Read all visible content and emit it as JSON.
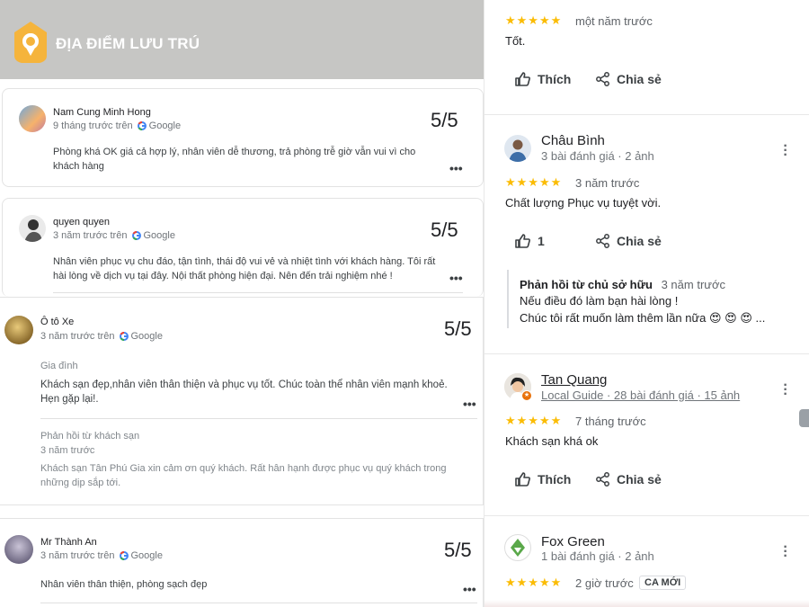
{
  "header": {
    "title": "ĐỊA ĐIỂM LƯU TRÚ"
  },
  "left_reviews": [
    {
      "name": "Nam Cung Minh Hong",
      "meta": "9 tháng trước trên",
      "source": "Google",
      "score": "5/5",
      "text": "Phòng khá OK giá cả hợp lý, nhân viên dễ thương, trả phòng trễ giờ vẫn vui vì cho khách hàng",
      "more": "•••"
    },
    {
      "name": "quyen quyen",
      "meta": "3 năm trước trên",
      "source": "Google",
      "score": "5/5",
      "text": "Nhân viên phục vụ chu đáo, tận tình, thái độ vui vẻ và nhiệt tình với khách hàng. Tôi rất hài lòng về dịch vụ tại đây. Nội thất phòng hiện đại. Nên đến trải nghiệm nhé !",
      "more": "•••"
    },
    {
      "name": "Ô tô Xe",
      "meta": "3 năm trước trên",
      "source": "Google",
      "score": "5/5",
      "tag": "Gia đình",
      "text": "Khách sạn đẹp,nhân viên thân thiện và phục vụ tốt. Chúc toàn thể nhân viên mạnh khoẻ. Hẹn gặp lại!.",
      "more": "•••",
      "reply_label": "Phản hồi từ khách sạn",
      "reply_time": "3 năm trước",
      "reply_text": "Khách sạn Tân Phú Gia xin cảm ơn quý khách. Rất hân hạnh được phục vụ quý khách trong những dịp sắp tới."
    },
    {
      "name": "Mr Thành An",
      "meta": "3 năm trước trên",
      "source": "Google",
      "score": "5/5",
      "text": "Nhân viên thân thiện, phòng sạch đẹp",
      "more": "•••"
    }
  ],
  "right_reviews": [
    {
      "stars": "★★★★★",
      "time": "một năm trước",
      "text": "Tốt.",
      "like": "Thích",
      "share": "Chia sẻ"
    },
    {
      "name": "Châu Bình",
      "meta": "3 bài đánh giá · 2 ảnh",
      "stars": "★★★★★",
      "time": "3 năm trước",
      "text": "Chất lượng Phục vụ tuyệt vời.",
      "like": "1",
      "share": "Chia sẻ",
      "reply_label": "Phản hồi từ chủ sở hữu",
      "reply_time": "3 năm trước",
      "reply_line1": "Nếu điều đó làm bạn hài lòng !",
      "reply_line2": "Chúc tôi rất muốn làm thêm lần nữa 😍 😍 😍 ..."
    },
    {
      "name": "Tan Quang",
      "meta": "Local Guide · 28 bài đánh giá · 15 ảnh",
      "stars": "★★★★★",
      "time": "7 tháng trước",
      "text": "Khách sạn khá ok",
      "like": "Thích",
      "share": "Chia sẻ"
    },
    {
      "name": "Fox Green",
      "meta": "1 bài đánh giá · 2 ảnh",
      "stars": "★★★★★",
      "time": "2 giờ trước",
      "badge": "CA MỚI"
    }
  ],
  "colors": {
    "star": "#fbbc04",
    "logo": "#f5b43c",
    "header_bg": "#c6c6c4"
  }
}
